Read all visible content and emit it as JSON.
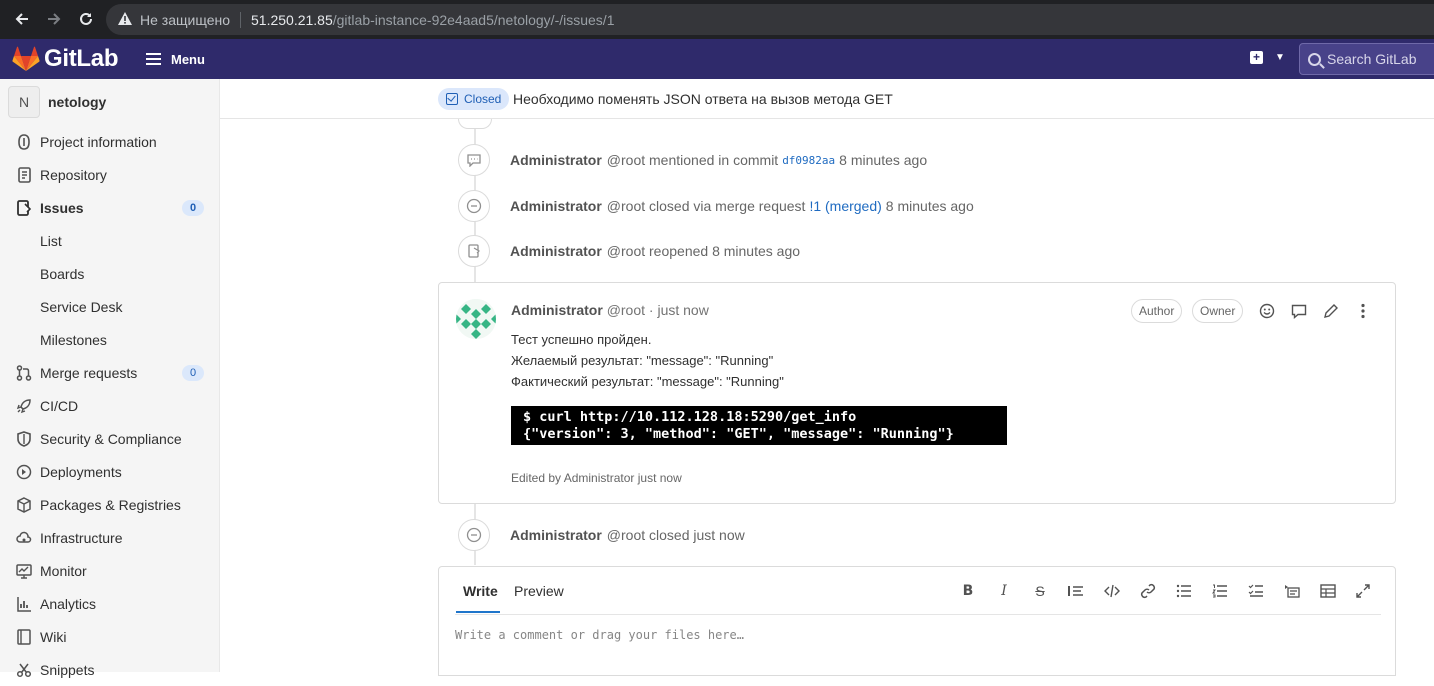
{
  "browser": {
    "security_label": "Не защищено",
    "url_host": "51.250.21.85",
    "url_path": "/gitlab-instance-92e4aad5/netology/-/issues/1"
  },
  "header": {
    "brand": "GitLab",
    "menu_label": "Menu",
    "search_placeholder": "Search GitLab",
    "brand_color": "#2f2a6b"
  },
  "sidebar": {
    "project_initial": "N",
    "project_name": "netology",
    "items": [
      {
        "label": "Project information",
        "icon": "info-icon"
      },
      {
        "label": "Repository",
        "icon": "document-icon"
      },
      {
        "label": "Issues",
        "icon": "issues-icon",
        "badge": "0"
      },
      {
        "label": "List"
      },
      {
        "label": "Boards"
      },
      {
        "label": "Service Desk"
      },
      {
        "label": "Milestones"
      },
      {
        "label": "Merge requests",
        "icon": "merge-request-icon",
        "badge": "0"
      },
      {
        "label": "CI/CD",
        "icon": "rocket-icon"
      },
      {
        "label": "Security & Compliance",
        "icon": "shield-icon"
      },
      {
        "label": "Deployments",
        "icon": "deployments-icon"
      },
      {
        "label": "Packages & Registries",
        "icon": "package-icon"
      },
      {
        "label": "Infrastructure",
        "icon": "cloud-gear-icon"
      },
      {
        "label": "Monitor",
        "icon": "monitor-icon"
      },
      {
        "label": "Analytics",
        "icon": "chart-icon"
      },
      {
        "label": "Wiki",
        "icon": "book-icon"
      },
      {
        "label": "Snippets",
        "icon": "snippet-icon"
      }
    ]
  },
  "issue": {
    "status": "Closed",
    "title": "Необходимо поменять JSON ответа на вызов метода GET"
  },
  "timeline": {
    "events": [
      {
        "author": "Administrator",
        "text_before": "@root mentioned in commit",
        "link": "df0982aa",
        "text_after": "8 minutes ago"
      },
      {
        "author": "Administrator",
        "text_before": "@root closed via merge request",
        "link": "!1 (merged)",
        "text_after": "8 minutes ago"
      },
      {
        "author": "Administrator",
        "text_before": "@root reopened 8 minutes ago"
      },
      {
        "author": "Administrator",
        "text_before": "@root closed just now"
      }
    ],
    "note": {
      "author": "Administrator",
      "meta": "@root · just now",
      "badge_author": "Author",
      "badge_owner": "Owner",
      "line1": "Тест успешно пройден.",
      "line2": "Желаемый результат: \"message\": \"Running\"",
      "line3": "Фактический результат: \"message\": \"Running\"",
      "code_line1": "$ curl http://10.112.128.18:5290/get_info",
      "code_line2": "{\"version\": 3, \"method\": \"GET\", \"message\": \"Running\"}",
      "edited": "Edited by Administrator just now"
    }
  },
  "editor": {
    "tab_write": "Write",
    "tab_preview": "Preview",
    "placeholder": "Write a comment or drag your files here…"
  }
}
